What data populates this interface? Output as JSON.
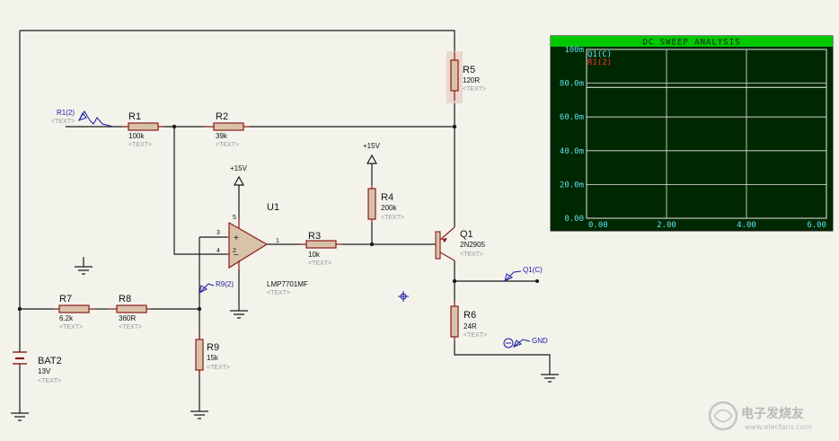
{
  "schematic": {
    "r1": {
      "name": "R1",
      "value": "100k",
      "text": "<TEXT>"
    },
    "r2": {
      "name": "R2",
      "value": "39k",
      "text": "<TEXT>"
    },
    "r3": {
      "name": "R3",
      "value": "10k",
      "text": "<TEXT>"
    },
    "r4": {
      "name": "R4",
      "value": "200k",
      "text": "<TEXT>"
    },
    "r5": {
      "name": "R5",
      "value": "120R",
      "text": "<TEXT>"
    },
    "r6": {
      "name": "R6",
      "value": "24R",
      "text": "<TEXT>"
    },
    "r7": {
      "name": "R7",
      "value": "6.2k",
      "text": "<TEXT>"
    },
    "r8": {
      "name": "R8",
      "value": "360R",
      "text": "<TEXT>"
    },
    "r9": {
      "name": "R9",
      "value": "15k",
      "text": "<TEXT>"
    },
    "u1": {
      "name": "U1",
      "value": "LMP7701MF",
      "text": "<TEXT>",
      "pin_plus": "+",
      "pin_minus": "−",
      "pin3": "3",
      "pin4": "4",
      "pin5": "5",
      "pin2": "2",
      "pin1": "1"
    },
    "q1": {
      "name": "Q1",
      "value": "2N2905",
      "text": "<TEXT>"
    },
    "bat2": {
      "name": "BAT2",
      "value": "13V",
      "text": "<TEXT>"
    },
    "supply_u1": "+15V",
    "supply_r4": "+15V",
    "probe_r1": "R1(2)",
    "probe_r1_text": "<TEXT>",
    "probe_r9": "R9(2)",
    "probe_q1": "Q1(C)",
    "gnd_label": "GND"
  },
  "graph": {
    "title": "DC SWEEP ANALYSIS",
    "legend": [
      {
        "name": "Q1(C)",
        "color": "#5fe0f0"
      },
      {
        "name": "R1(2)",
        "color": "#ff3030"
      }
    ],
    "y_ticks": [
      "100m",
      "80.0m",
      "60.0m",
      "40.0m",
      "20.0m",
      "0.00"
    ],
    "x_ticks": [
      "0.00",
      "2.00",
      "4.00",
      "6.00"
    ],
    "colors": {
      "background": "#002800",
      "grid": "#e8e8e8",
      "title_bar": "#00c800",
      "trace": "#d8d8d8"
    }
  },
  "chart_data": {
    "type": "line",
    "title": "DC SWEEP ANALYSIS",
    "xlim": [
      0,
      6
    ],
    "ylim": [
      0,
      0.1
    ],
    "grid": true,
    "legend_placement": "top-left",
    "series": [
      {
        "name": "Q1(C)",
        "x": [
          0,
          6
        ],
        "y": [
          0.0775,
          0.0775
        ]
      }
    ]
  },
  "watermark": {
    "text": "电子发烧友",
    "sub": "www.elecfans.com"
  }
}
